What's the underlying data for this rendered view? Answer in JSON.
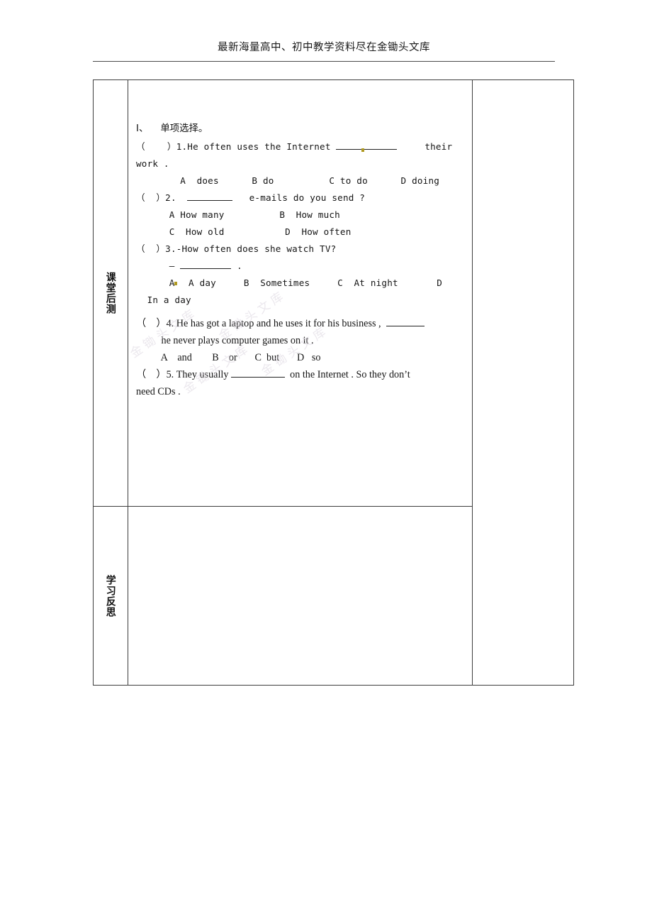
{
  "header": {
    "text": "最新海量高中、初中教学资料尽在金锄头文库"
  },
  "watermark": {
    "streak_1": "金锄头文库",
    "streak_2": "金锄头文库",
    "streak_3": "金锄头文库",
    "streak_4": "金锄头文库"
  },
  "table": {
    "rows": [
      {
        "label": "课堂后测",
        "section_title": "I、    单项选择。",
        "questions": [
          {
            "number": "1",
            "bracket": "（    ）",
            "stem_prefix": "1.He often uses the Internet ",
            "stem_suffix": "     their",
            "stem_wrap": "work .",
            "options_lines": [
              "        A  does      B do          C to do      D doing"
            ]
          },
          {
            "number": "2",
            "bracket": "（  ）",
            "stem_prefix": "2.  ",
            "stem_suffix": "   e-mails do you send ?",
            "options_lines": [
              "      A How many          B  How much",
              "      C  How old           D  How often"
            ]
          },
          {
            "number": "3",
            "bracket": "（  ）",
            "stem_prefix": "3.-How often does she watch TV?",
            "answer_dash": "–",
            "answer_tail": " .",
            "options_lines": [
              "      A  A day     B  Sometimes     C  At night       D",
              "  In a day"
            ]
          },
          {
            "number": "4",
            "bracket": "（    ）",
            "stem_prefix": "4. He has got a laptop and he uses it for his business ,  ",
            "stem_wrap": "          he never plays computer games on it .",
            "options_lines": [
              "          A    and        B    or       C  but       D   so"
            ]
          },
          {
            "number": "5",
            "bracket": "（    ）",
            "stem_prefix": "5. They usually ",
            "stem_suffix": "  on the Internet . So they don’t",
            "stem_wrap": "need CDs ."
          }
        ]
      },
      {
        "label": "学习反思",
        "content": ""
      }
    ]
  }
}
